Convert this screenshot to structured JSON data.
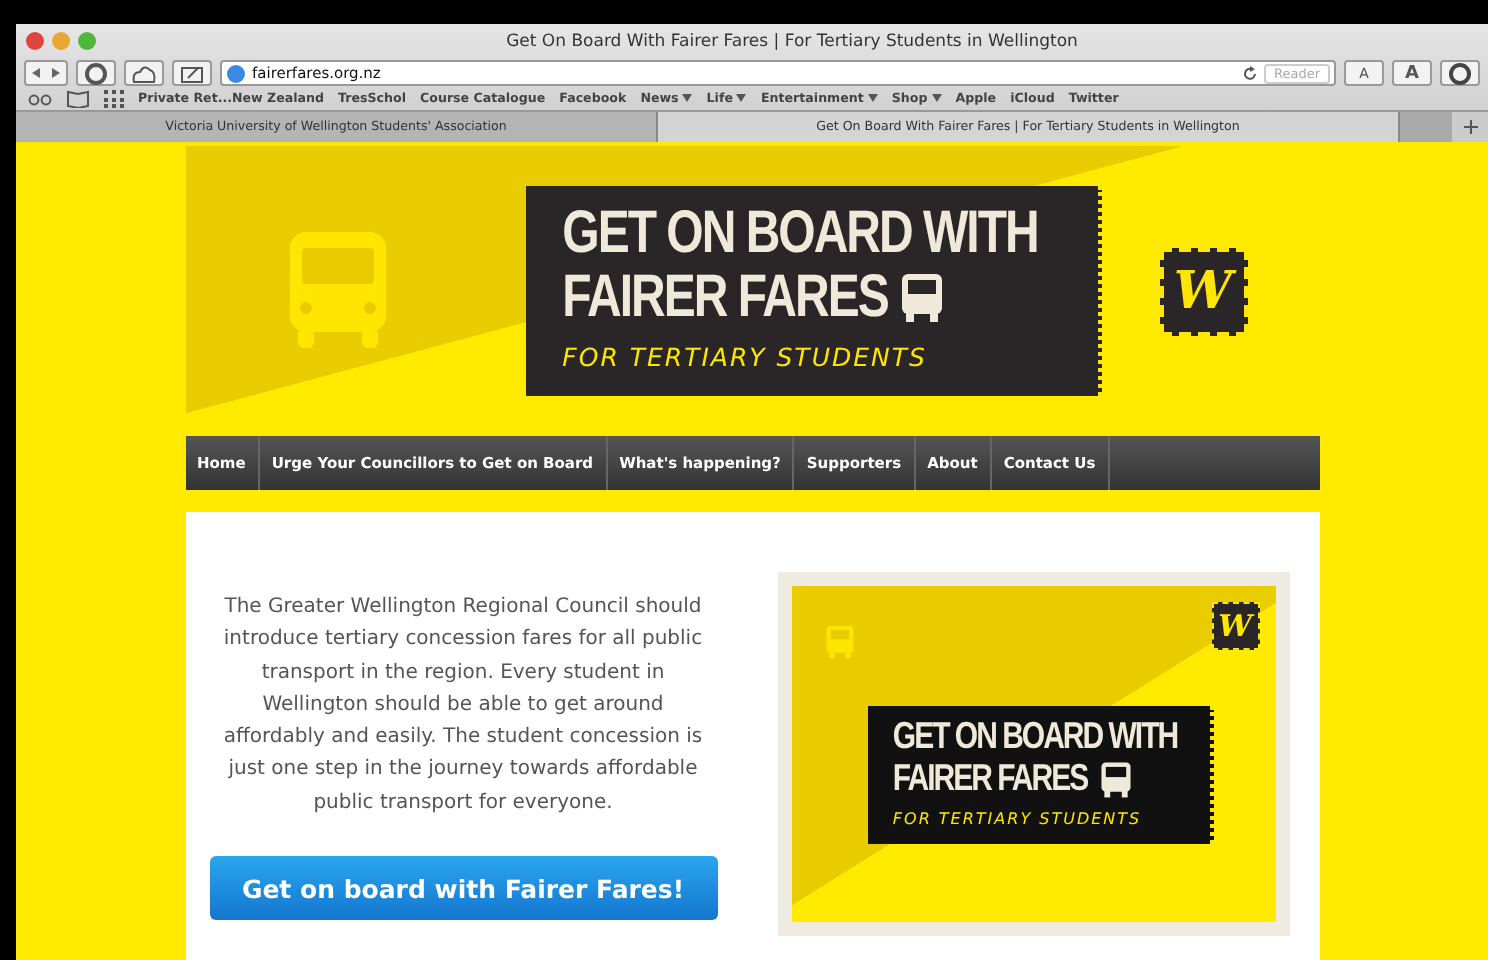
{
  "window": {
    "title": "Get On Board With Fairer Fares | For Tertiary Students in Wellington"
  },
  "toolbar": {
    "url": "fairerfares.org.nz",
    "reader": "Reader",
    "font_small": "A",
    "font_large": "A"
  },
  "bookmarks": [
    {
      "label": "Private Ret...New Zealand",
      "menu": false
    },
    {
      "label": "TresSchol",
      "menu": false
    },
    {
      "label": "Course Catalogue",
      "menu": false
    },
    {
      "label": "Facebook",
      "menu": false
    },
    {
      "label": "News",
      "menu": true
    },
    {
      "label": "Life",
      "menu": true
    },
    {
      "label": "Entertainment",
      "menu": true
    },
    {
      "label": "Shop",
      "menu": true
    },
    {
      "label": "Apple",
      "menu": false
    },
    {
      "label": "iCloud",
      "menu": false
    },
    {
      "label": "Twitter",
      "menu": false
    }
  ],
  "tabs": [
    {
      "label": "Victoria University of Wellington Students' Association",
      "selected": false
    },
    {
      "label": "Get On Board With Fairer Fares | For Tertiary Students in Wellington",
      "selected": true
    }
  ],
  "banner": {
    "line1": "GET ON BOARD WITH",
    "line2": "FAIRER FARES",
    "line3": "FOR TERTIARY STUDENTS",
    "logo": "W"
  },
  "nav": [
    {
      "label": "Home"
    },
    {
      "label": "Urge Your Councillors to Get on Board"
    },
    {
      "label": "What's happening?"
    },
    {
      "label": "Supporters"
    },
    {
      "label": "About"
    },
    {
      "label": "Contact Us"
    }
  ],
  "intro": "The Greater Wellington Regional Council should introduce tertiary concession fares for all public transport in the region. Every student in Wellington should be able to get around affordably and easily. The student concession is just one step in the journey towards affordable public transport for everyone.",
  "cta": "Get on board with Fairer Fares!",
  "poster": {
    "line1": "GET ON BOARD WITH",
    "line2": "FAIRER FARES",
    "line3": "FOR TERTIARY STUDENTS",
    "logo": "W"
  }
}
